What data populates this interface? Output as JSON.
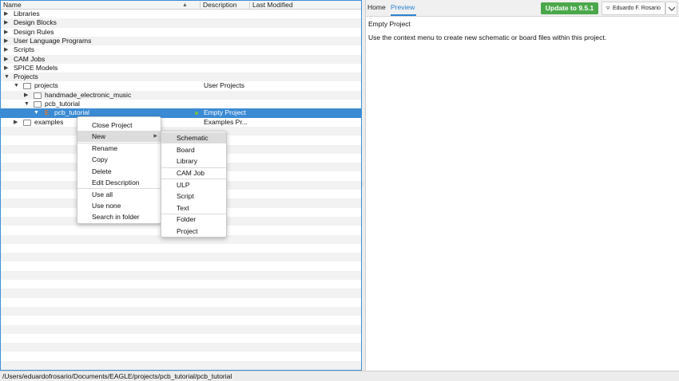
{
  "tree": {
    "headers": {
      "name": "Name",
      "sort_indicator": "▲",
      "description": "Description",
      "last_modified": "Last Modified"
    },
    "rows": [
      {
        "label": "Libraries",
        "description": ""
      },
      {
        "label": "Design Blocks",
        "description": ""
      },
      {
        "label": "Design Rules",
        "description": ""
      },
      {
        "label": "User Language Programs",
        "description": ""
      },
      {
        "label": "Scripts",
        "description": ""
      },
      {
        "label": "CAM Jobs",
        "description": ""
      },
      {
        "label": "SPICE Models",
        "description": ""
      },
      {
        "label": "Projects",
        "description": ""
      },
      {
        "label": "projects",
        "description": "User Projects"
      },
      {
        "label": "handmade_electronic_music",
        "description": ""
      },
      {
        "label": "pcb_tutorial",
        "description": ""
      },
      {
        "label": "pcb_tutorial",
        "description": "Empty Project"
      },
      {
        "label": "examples",
        "description": "Examples Pr..."
      }
    ]
  },
  "preview": {
    "tabs": [
      "Home",
      "Preview"
    ],
    "update_button": "Update to 9.5.1",
    "user_name": "Eduardo F. Rosario",
    "title": "Empty Project",
    "text": "Use the context menu to create new schematic or board files within this project."
  },
  "context_menu": {
    "items": [
      "Close Project",
      "New",
      "Rename",
      "Copy",
      "Delete",
      "Edit Description",
      "Use all",
      "Use none",
      "Search in folder"
    ]
  },
  "submenu": {
    "items": [
      "Schematic",
      "Board",
      "Library",
      "CAM Job",
      "ULP",
      "Script",
      "Text",
      "Folder",
      "Project"
    ]
  },
  "status_bar": {
    "path": "/Users/eduardofrosario/Documents/EAGLE/projects/pcb_tutorial/pcb_tutorial"
  },
  "colors": {
    "selection": "#3a8ad4",
    "accent": "#2c84d0",
    "update_button": "#4aa84a",
    "eagle_icon": "#e07a2a"
  }
}
